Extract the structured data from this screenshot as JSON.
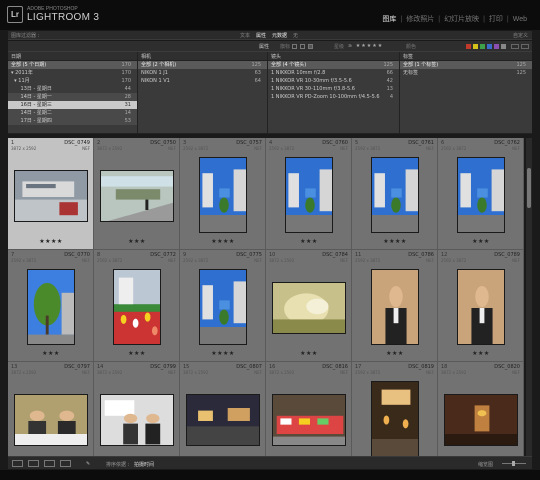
{
  "app": {
    "badge": "Lr",
    "brand_sub": "ADOBE PHOTOSHOP",
    "brand_main": "LIGHTROOM 3",
    "modules": [
      "图库",
      "修改照片",
      "幻灯片放映",
      "打印",
      "Web"
    ],
    "active_module": "图库"
  },
  "filter_bar": {
    "title": "图库过滤器 :",
    "tabs": [
      "文本",
      "属性",
      "元数据",
      "无"
    ],
    "active_tab": "元数据",
    "preset": "自定义"
  },
  "attribute_bar": {
    "label": "属性",
    "flag_label": "旗标",
    "rating_label": "星级",
    "color_label": "颜色",
    "colors": [
      "#c0392b",
      "#d4c21a",
      "#3fa04a",
      "#3a6bc8",
      "#8a4fb0",
      "#888888"
    ]
  },
  "metadata_browser": {
    "columns": [
      {
        "header": "日期",
        "rows": [
          {
            "label": "全部 (5 个日期)",
            "count": "170",
            "style": "sel"
          },
          {
            "label": "▾ 2011年",
            "count": "170",
            "style": ""
          },
          {
            "label": "  ▾ 11月",
            "count": "170",
            "style": ""
          },
          {
            "label": "      13日 - 星期日",
            "count": "44",
            "style": ""
          },
          {
            "label": "      14日 - 星期一",
            "count": "28",
            "style": "sel2"
          },
          {
            "label": "      16日 - 星期三",
            "count": "31",
            "style": "hl"
          },
          {
            "label": "      14日 - 星期二",
            "count": "14",
            "style": "sel2"
          },
          {
            "label": "      17日 - 星期四",
            "count": "53",
            "style": "sel2"
          }
        ]
      },
      {
        "header": "相机",
        "rows": [
          {
            "label": "全部 (2 个相机)",
            "count": "125",
            "style": "sel"
          },
          {
            "label": "NIKON 1 J1",
            "count": "63",
            "style": ""
          },
          {
            "label": "NIKON 1 V1",
            "count": "64",
            "style": ""
          }
        ]
      },
      {
        "header": "镜头",
        "rows": [
          {
            "label": "全部 (4 个镜头)",
            "count": "125",
            "style": "sel"
          },
          {
            "label": "1 NIKKOR 10mm f/2.8",
            "count": "66",
            "style": ""
          },
          {
            "label": "1 NIKKOR VR 10-30mm f/3.5-5.6",
            "count": "42",
            "style": ""
          },
          {
            "label": "1 NIKKOR VR 30-110mm f/3.8-5.6",
            "count": "13",
            "style": ""
          },
          {
            "label": "1 NIKKOR VR PD-Zoom 10-100mm f/4.5-5.6",
            "count": "4",
            "style": ""
          }
        ]
      },
      {
        "header": "标签",
        "rows": [
          {
            "label": "全部 (1 个标签)",
            "count": "125",
            "style": "sel"
          },
          {
            "label": "无标签",
            "count": "125",
            "style": ""
          }
        ]
      }
    ]
  },
  "grid": {
    "cells": [
      {
        "index": "1",
        "filename": "DSC_0749",
        "dims": "3872 x 2592",
        "ext": "NEF",
        "stars": "★★★★",
        "orient": "land",
        "scene": "station",
        "selected": true
      },
      {
        "index": "2",
        "filename": "DSC_0750",
        "dims": "3872 x 2592",
        "ext": "NEF",
        "stars": "★★★",
        "orient": "land",
        "scene": "platform"
      },
      {
        "index": "3",
        "filename": "DSC_0757",
        "dims": "2592 x 3872",
        "ext": "NEF",
        "stars": "★★★★",
        "orient": "port",
        "scene": "street"
      },
      {
        "index": "4",
        "filename": "DSC_0760",
        "dims": "2592 x 3872",
        "ext": "NEF",
        "stars": "★★★",
        "orient": "port",
        "scene": "street"
      },
      {
        "index": "5",
        "filename": "DSC_0761",
        "dims": "2592 x 3872",
        "ext": "NEF",
        "stars": "★★★★",
        "orient": "port",
        "scene": "street"
      },
      {
        "index": "6",
        "filename": "DSC_0762",
        "dims": "2592 x 3872",
        "ext": "NEF",
        "stars": "★★★",
        "orient": "port",
        "scene": "street"
      },
      {
        "index": "7",
        "filename": "DSC_0770",
        "dims": "2592 x 3872",
        "ext": "NEF",
        "stars": "★★★",
        "orient": "port",
        "scene": "tree"
      },
      {
        "index": "8",
        "filename": "DSC_0772",
        "dims": "2592 x 3872",
        "ext": "NEF",
        "stars": "★★★",
        "orient": "port",
        "scene": "flowers"
      },
      {
        "index": "9",
        "filename": "DSC_0775",
        "dims": "2592 x 3872",
        "ext": "NEF",
        "stars": "★★★★",
        "orient": "port",
        "scene": "street"
      },
      {
        "index": "10",
        "filename": "DSC_0784",
        "dims": "3872 x 2592",
        "ext": "NEF",
        "stars": "★★★",
        "orient": "land",
        "scene": "blur"
      },
      {
        "index": "11",
        "filename": "DSC_0786",
        "dims": "2592 x 3872",
        "ext": "NEF",
        "stars": "★★★",
        "orient": "port",
        "scene": "person"
      },
      {
        "index": "12",
        "filename": "DSC_0789",
        "dims": "2592 x 3872",
        "ext": "NEF",
        "stars": "★★★",
        "orient": "port",
        "scene": "person"
      },
      {
        "index": "13",
        "filename": "DSC_0797",
        "dims": "3872 x 2592",
        "ext": "NEF",
        "stars": "",
        "orient": "land",
        "scene": "meeting"
      },
      {
        "index": "14",
        "filename": "DSC_0799",
        "dims": "3872 x 2592",
        "ext": "NEF",
        "stars": "",
        "orient": "land",
        "scene": "meeting2"
      },
      {
        "index": "15",
        "filename": "DSC_0807",
        "dims": "3872 x 2592",
        "ext": "NEF",
        "stars": "",
        "orient": "land",
        "scene": "night"
      },
      {
        "index": "16",
        "filename": "DSC_0816",
        "dims": "3872 x 2592",
        "ext": "NEF",
        "stars": "",
        "orient": "land",
        "scene": "market"
      },
      {
        "index": "17",
        "filename": "DSC_0819",
        "dims": "2592 x 3872",
        "ext": "NEF",
        "stars": "",
        "orient": "port",
        "scene": "alley"
      },
      {
        "index": "18",
        "filename": "DSC_0820",
        "dims": "3872 x 2592",
        "ext": "NEF",
        "stars": "",
        "orient": "land",
        "scene": "restaurant"
      }
    ]
  },
  "toolbar": {
    "sort_label": "排序依据 :",
    "sort_value": "拍摄时间",
    "thumb_label": "缩览图"
  }
}
